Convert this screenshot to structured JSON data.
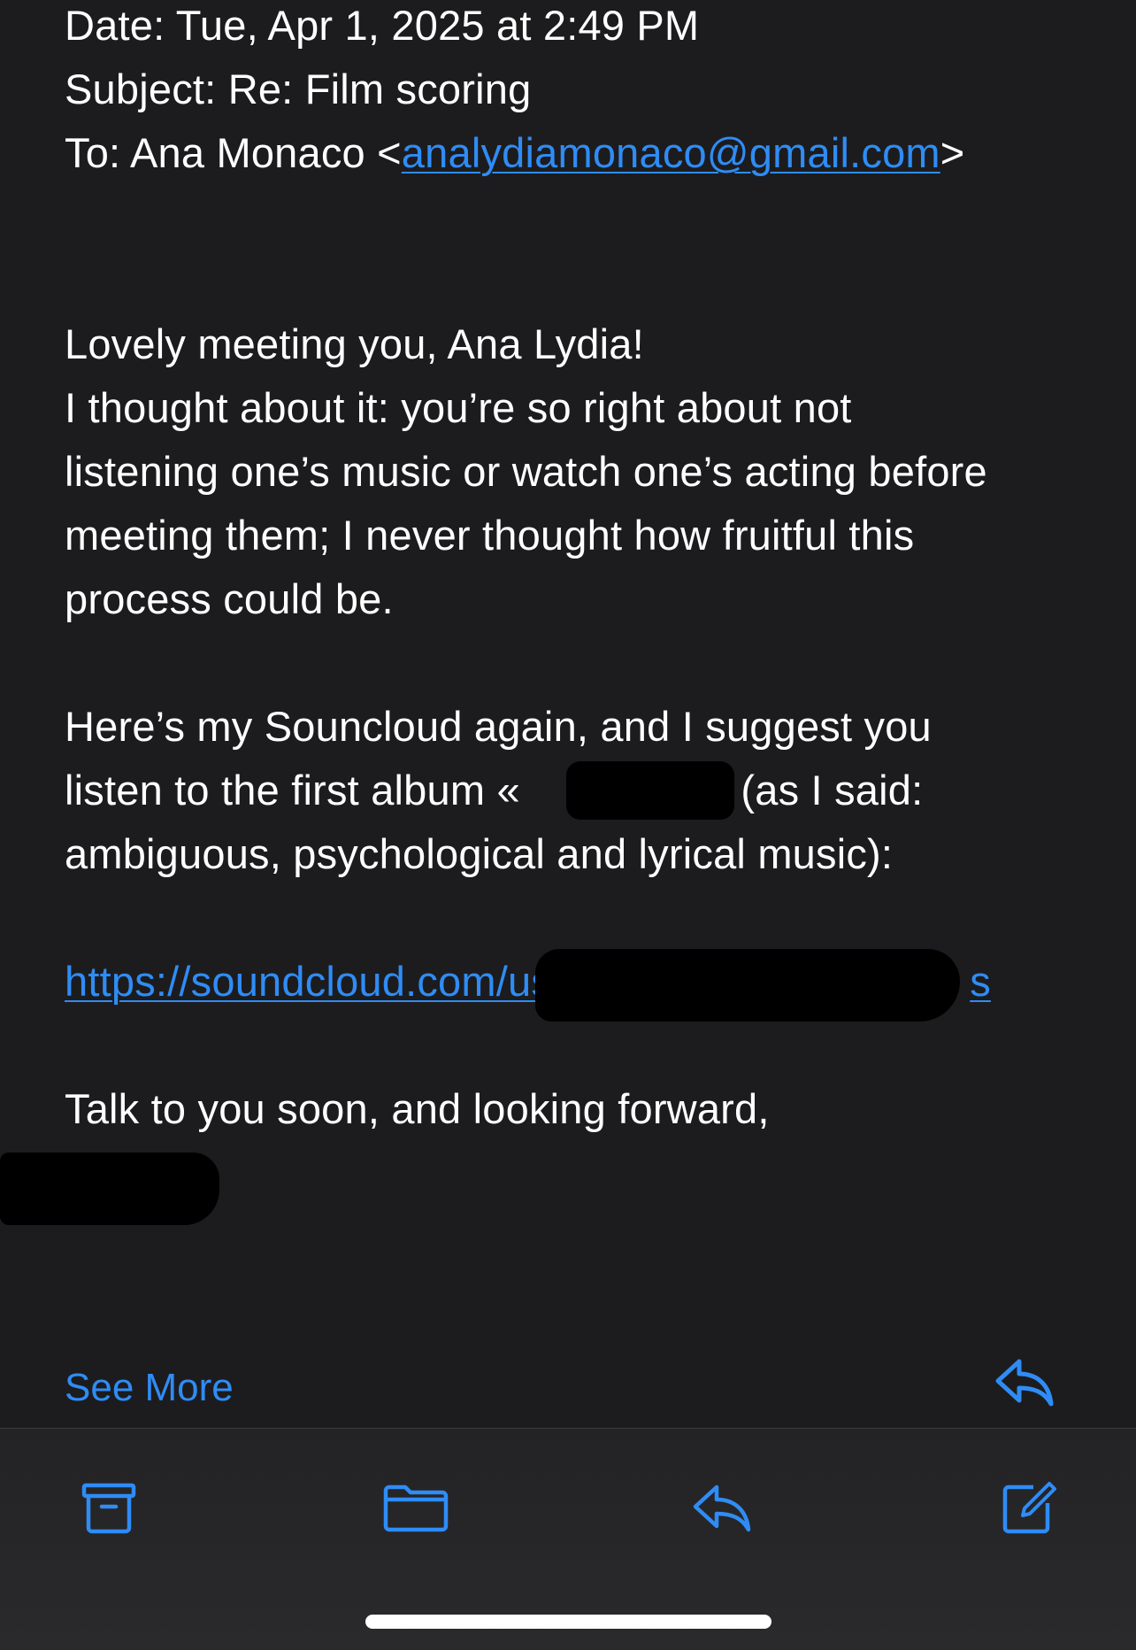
{
  "header": {
    "date_label": "Date:",
    "date_value": "Tue, Apr 1, 2025 at 2:49 PM",
    "subject_label": "Subject:",
    "subject_value": "Re: Film scoring",
    "to_label": "To:",
    "to_name": "Ana Monaco <",
    "to_email": "analydiamonaco@gmail.com",
    "to_close": ">"
  },
  "body": {
    "greeting": "Lovely meeting you, Ana Lydia!",
    "p1_l1": "I thought about it: you’re so right about not",
    "p1_l2": "listening one’s music or watch one’s acting before",
    "p1_l3": "meeting them; I never thought how fruitful this",
    "p1_l4": "process could be.",
    "p2_l1": "Here’s my Souncloud again, and I suggest you",
    "p2_l2_a": "listen to the first album «",
    "p2_l2_b": "» (as I said:",
    "p2_l3": "ambiguous, psychological and lyrical music):",
    "link_visible_start": "https://soundcloud.com/user",
    "link_visible_end": "s",
    "closing": "Talk to you soon, and looking forward,"
  },
  "footer": {
    "see_more": "See More"
  },
  "toolbar": {
    "items": [
      "archive-icon",
      "folder-icon",
      "reply-icon",
      "compose-icon"
    ]
  },
  "colors": {
    "background": "#1c1c1e",
    "accent": "#2f8cf5",
    "text": "#ffffff"
  }
}
